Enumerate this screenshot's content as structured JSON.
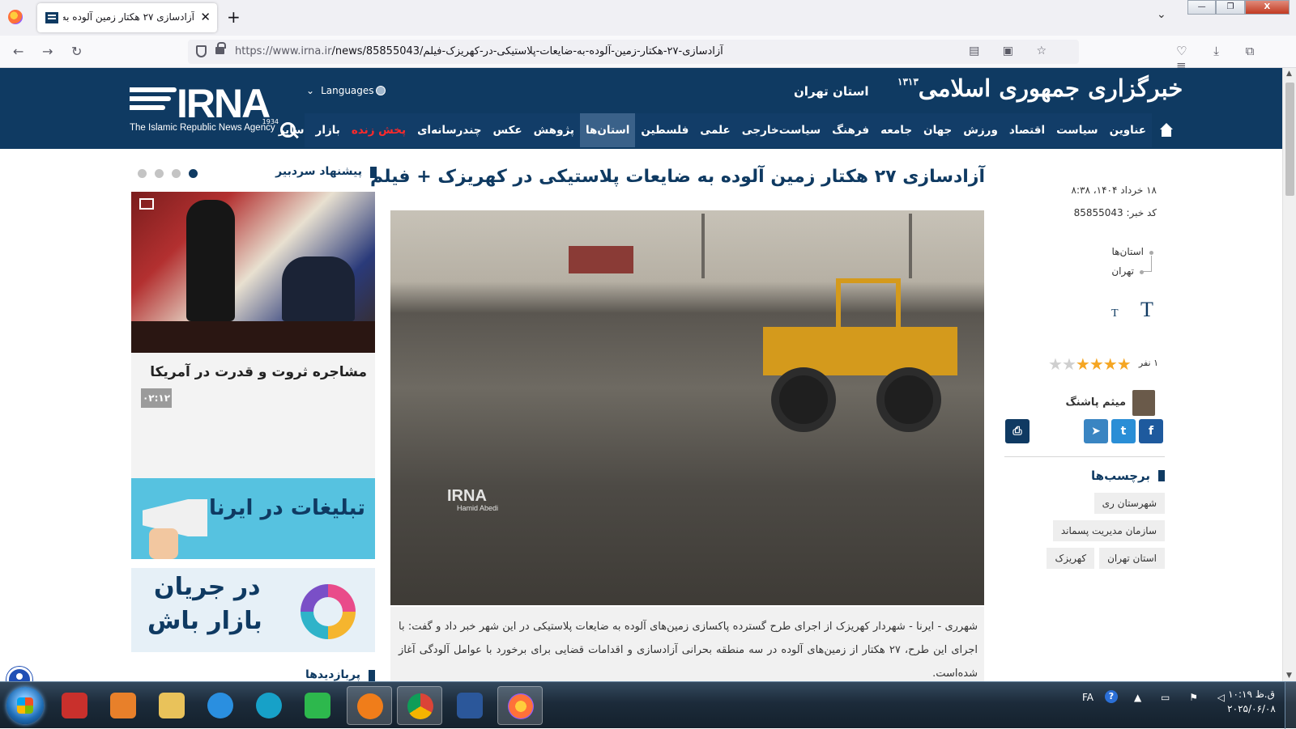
{
  "browser": {
    "tab_title": "آزادسازی ۲۷ هکتار زمین آلوده به ضایعات",
    "tab_close": "✕",
    "new_tab": "+",
    "url_prefix": "https://www.irna.ir",
    "url_path": "/news/85855043/آزادسازی-۲۷-هکتار-زمین-آلوده-به-ضایعات-پلاستیکی-در-کهریزک-فیلم",
    "nav": {
      "back": "←",
      "forward": "→",
      "reload": "↻"
    },
    "url_icons": "▤ ▣ ☆",
    "right_tools": "♡ ⤓ ⧉ ≡",
    "window_buttons": {
      "minimize": "—",
      "maximize": "❐",
      "close": "X"
    }
  },
  "header": {
    "logo_word": "IRNA",
    "logo_year": "1934",
    "logo_tagline": "The Islamic Republic News Agency",
    "languages": "Languages",
    "province": "استان تهران",
    "site_name": "خبرگزاری جمهوری اسلامی",
    "site_year": "۱۳۱۳"
  },
  "menu": {
    "items": [
      {
        "label": "عناوین"
      },
      {
        "label": "سیاست"
      },
      {
        "label": "اقتصاد"
      },
      {
        "label": "ورزش"
      },
      {
        "label": "جهان"
      },
      {
        "label": "جامعه"
      },
      {
        "label": "فرهنگ"
      },
      {
        "label": "سیاست‌خارجی"
      },
      {
        "label": "علمی"
      },
      {
        "label": "فلسطین"
      },
      {
        "label": "استان‌ها",
        "active": true
      },
      {
        "label": "پژوهش"
      },
      {
        "label": "عکس"
      },
      {
        "label": "چندرسانه‌ای"
      },
      {
        "label": "پخش زنده",
        "live": true
      },
      {
        "label": "بازار"
      },
      {
        "label": "سایر"
      }
    ]
  },
  "article": {
    "date": "۱۸ خرداد ۱۴۰۴، ۸:۳۸",
    "code": "کد خبر: 85855043",
    "breadcrumb": [
      "استان‌ها",
      "تهران"
    ],
    "font_large": "T",
    "font_small": "T",
    "rating_count": "۱ نفر",
    "rating": {
      "value": 4,
      "max": 6
    },
    "author": "میثم پاشنگ",
    "share": {
      "facebook": "f",
      "twitter": "t",
      "telegram": "➤",
      "print": "⎙"
    },
    "headline": "آزادسازی ۲۷ هکتار زمین آلوده به ضایعات پلاستیکی در کهریزک + فیلم",
    "photo_watermark": "IRNA",
    "photo_credit": "Hamid Abedi",
    "lead": "شهرری - ایرنا - شهردار کهریزک از اجرای طرح گسترده پاکسازی زمین‌های آلوده به ضایعات پلاستیکی در این شهر خبر داد و گفت: با اجرای این طرح، ۲۷ هکتار از زمین‌های آلوده در سه منطقه بحرانی آزادسازی و اقدامات قضایی برای برخورد با عوامل آلودگی آغاز شده‌است."
  },
  "tags": {
    "title": "برچسب‌ها",
    "items": [
      "شهرستان ری",
      "سازمان مدیریت پسماند",
      "استان تهران",
      "کهریزک"
    ]
  },
  "sidebar": {
    "pick_title": "پیشنهاد سردبیر",
    "pick_caption": "مشاجره ثروت و قدرت در آمریکا",
    "pick_duration": "۰۲:۱۲",
    "ad1_text": "تبلیغات در ایرنا",
    "ad2_line1": "در جریان",
    "ad2_line2": "بازار باش",
    "popular_title": "پربازدیدها"
  },
  "taskbar": {
    "lang": "FA",
    "help": "?",
    "sys_icons": "▲ ▭ ⚑ ◁",
    "time": "ق.ظ ۱۰:۱۹",
    "date": "۲۰۲۵/۰۶/۰۸"
  },
  "colors": {
    "brand_navy": "#0f3a62",
    "live_red": "#ff2a2a",
    "star_gold": "#f5a623"
  }
}
